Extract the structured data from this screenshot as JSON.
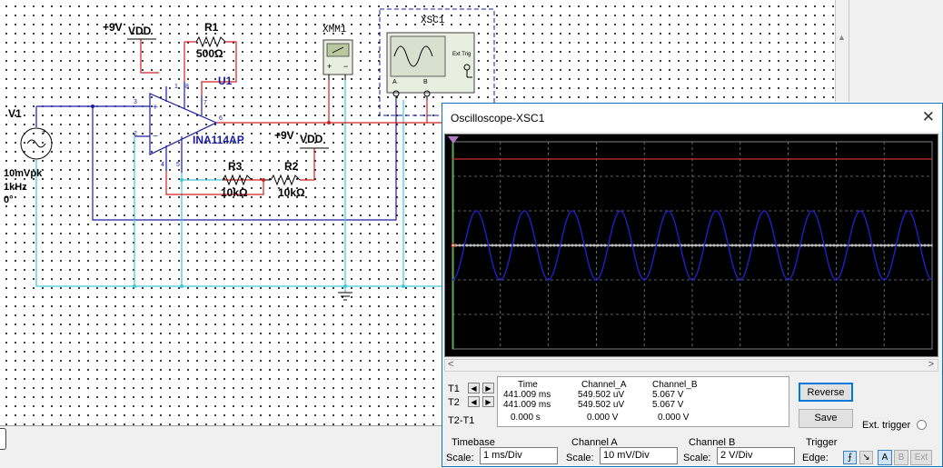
{
  "schematic": {
    "v1_name": "V1",
    "v1_amp": "10mVpk",
    "v1_freq": "1kHz",
    "v1_phase": "0°",
    "supply1": "+9V",
    "vdd1": "VDD",
    "r1_name": "R1",
    "r1_value": "500Ω",
    "u1_name": "U1",
    "u1_part": "INA114AP",
    "supply2": "+9V",
    "vdd2": "VDD",
    "r3_name": "R3",
    "r3_value": "10kΩ",
    "r2_name": "R2",
    "r2_value": "10kΩ",
    "xmm1_name": "XMM1",
    "xsc1_name": "XSC1",
    "xsc1_ext_trig": "Ext Trig",
    "xsc1_a": "A",
    "xsc1_b": "B",
    "pins": {
      "p1": "1",
      "p2": "2",
      "p3": "3",
      "p4": "4",
      "p5": "5",
      "p6": "6",
      "p7": "7",
      "p8": "8"
    }
  },
  "oscilloscope": {
    "title": "Oscilloscope-XSC1",
    "colors": {
      "channel_a": "#c83232",
      "channel_b": "#2020c8",
      "trigger": "#ffffff",
      "grid": "#808080"
    },
    "grid_divisions": {
      "x": 10,
      "y": 6
    },
    "channel_a_level_div": 2.5,
    "channel_b_amplitude_div": 1.0,
    "channel_b_cycles": 10,
    "cursors": {
      "t1_label": "T1",
      "t2_label": "T2",
      "t2t1_label": "T2-T1",
      "headers": {
        "time": "Time",
        "channel_a": "Channel_A",
        "channel_b": "Channel_B"
      },
      "t1": {
        "time": "441.009 ms",
        "channel_a": "549.502 uV",
        "channel_b": "5.067 V"
      },
      "t2": {
        "time": "441.009 ms",
        "channel_a": "549.502 uV",
        "channel_b": "5.067 V"
      },
      "t2t1": {
        "time": "0.000 s",
        "channel_a": "0.000 V",
        "channel_b": "0.000 V"
      }
    },
    "buttons": {
      "reverse": "Reverse",
      "save": "Save",
      "ext_trigger": "Ext. trigger"
    },
    "timebase": {
      "title": "Timebase",
      "scale_label": "Scale:",
      "scale_value": "1 ms/Div"
    },
    "channel_a": {
      "title": "Channel A",
      "scale_label": "Scale:",
      "scale_value": "10 mV/Div"
    },
    "channel_b": {
      "title": "Channel B",
      "scale_label": "Scale:",
      "scale_value": "2  V/Div"
    },
    "trigger": {
      "title": "Trigger",
      "edge_label": "Edge:",
      "sources": [
        "A",
        "B",
        "Ext"
      ]
    }
  }
}
